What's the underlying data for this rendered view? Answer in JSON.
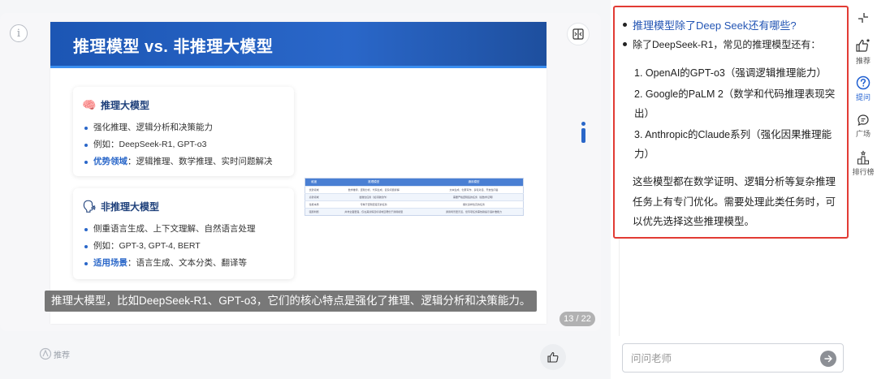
{
  "slide": {
    "title": "推理模型 vs. 非推理大模型",
    "cards": [
      {
        "title": "推理大模型",
        "emoji": "🧠",
        "bullets": [
          {
            "key": "",
            "text": "强化推理、逻辑分析和决策能力"
          },
          {
            "key": "",
            "text": "例如：DeepSeek-R1, GPT-o3"
          },
          {
            "key": "优势领域",
            "text": "：逻辑推理、数学推理、实时问题解决"
          }
        ]
      },
      {
        "title": "非推理大模型",
        "emoji": "🗣",
        "bullets": [
          {
            "key": "",
            "text": "侧重语言生成、上下文理解、自然语言处理"
          },
          {
            "key": "",
            "text": "例如：GPT-3, GPT-4, BERT"
          },
          {
            "key": "适用场景",
            "text": "：语言生成、文本分类、翻译等"
          }
        ]
      }
    ],
    "table": {
      "headers": [
        "维度",
        "推理模型",
        "通用模型"
      ],
      "rows": [
        [
          "优势领域",
          "数学推导、逻辑分析、代码生成、复杂问题拆解",
          "文本生成、创意写作、多轮对话、开放性问答"
        ],
        [
          "劣势领域",
          "发散性任务（如诗歌创作）",
          "需要严格逻辑链的任务（如数学证明）"
        ],
        [
          "性能本质",
          "专精于逻辑密度高的任务",
          "擅长多样性高的任务"
        ],
        [
          "强弱判断",
          "并非全面更强，仅在其训练目标领域显著优于通用模型",
          "通用场景更灵活，但专项任务需依赖提示语补偿能力"
        ]
      ]
    },
    "subtitle": "推理大模型，比如DeepSeek-R1、GPT-o3，它们的核心特点是强化了推理、逻辑分析和决策能力。",
    "page_counter": "13 / 22"
  },
  "footer": {
    "recommend_label": "推荐"
  },
  "chat": {
    "question": "推理模型除了Deep Seek还有哪些?",
    "answer_intro": "除了DeepSeek-R1，常见的推理模型还有：",
    "items": [
      "1. OpenAI的GPT-o3（强调逻辑推理能力）",
      "2. Google的PaLM 2（数学和代码推理表现突出）",
      "3. Anthropic的Claude系列（强化因果推理能力）"
    ],
    "summary": "这些模型都在数学证明、逻辑分析等复杂推理任务上有专门优化。需要处理此类任务时，可以优先选择这些推理模型。",
    "input_placeholder": "问问老师"
  },
  "toolbar": {
    "items": [
      {
        "label": "推荐",
        "icon": "thumbs-up-star-icon"
      },
      {
        "label": "提问",
        "icon": "question-icon",
        "active": true
      },
      {
        "label": "广场",
        "icon": "chat-bubble-icon"
      },
      {
        "label": "排行榜",
        "icon": "podium-icon"
      }
    ]
  },
  "colors": {
    "accent": "#1f5fd1",
    "highlight_border": "#e23b34",
    "slide_header": "#2a67c9"
  }
}
